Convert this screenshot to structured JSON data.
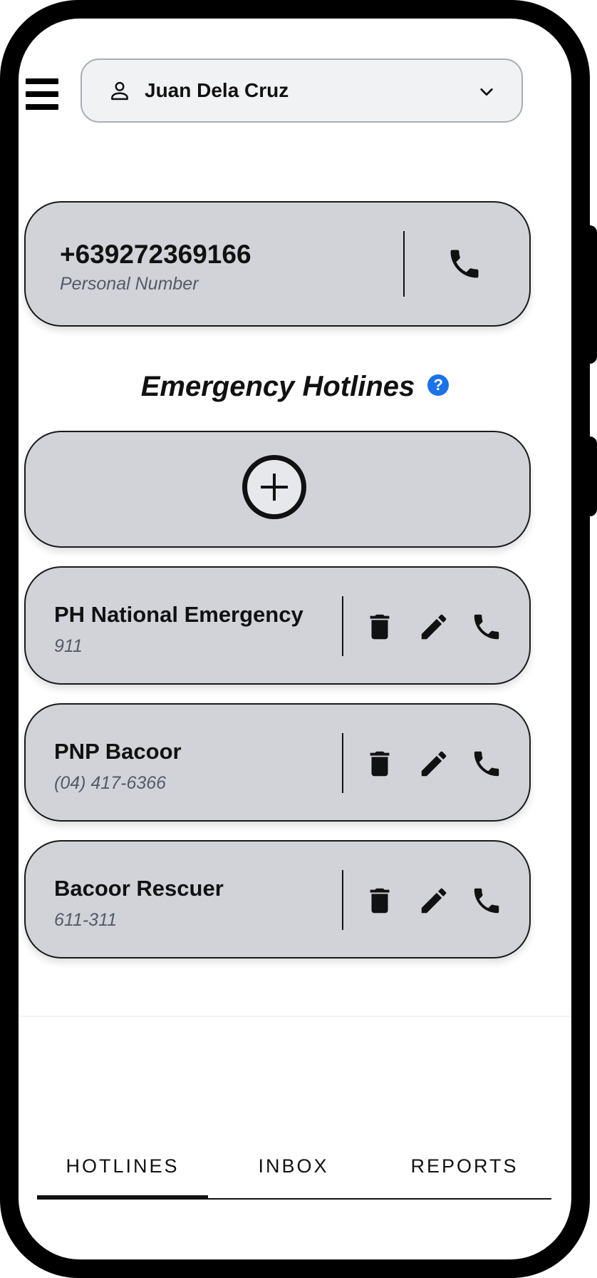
{
  "header": {
    "account_name": "Juan Dela Cruz"
  },
  "personal": {
    "number": "+639272369166",
    "label": "Personal Number"
  },
  "section": {
    "title": "Emergency Hotlines",
    "help_glyph": "?"
  },
  "hotlines": [
    {
      "name": "PH National Emergency",
      "number": "911"
    },
    {
      "name": "PNP Bacoor",
      "number": "(04) 417-6366"
    },
    {
      "name": "Bacoor Rescuer",
      "number": "611-311"
    }
  ],
  "tabs": [
    {
      "label": "HOTLINES",
      "active": true
    },
    {
      "label": "INBOX",
      "active": false
    },
    {
      "label": "REPORTS",
      "active": false
    }
  ],
  "colors": {
    "card_bg": "#d1d3d9",
    "accent_help": "#1a73e8",
    "text": "#111111",
    "subtext": "#555a66"
  },
  "icons": [
    "menu-icon",
    "user-icon",
    "chevron-down-icon",
    "phone-icon",
    "help-icon",
    "add-icon",
    "trash-icon",
    "pencil-icon"
  ]
}
